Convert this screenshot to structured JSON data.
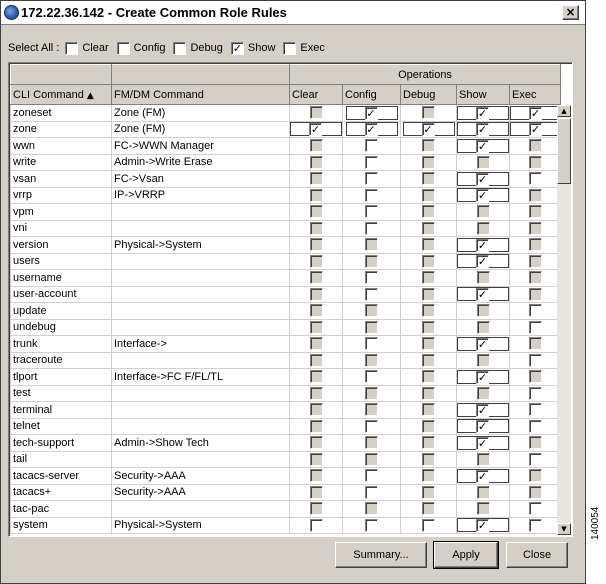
{
  "window": {
    "title": "172.22.36.142 - Create Common Role Rules",
    "close_symbol": "×"
  },
  "select_all": {
    "label": "Select All :",
    "options": [
      {
        "label": "Clear",
        "checked": false
      },
      {
        "label": "Config",
        "checked": false
      },
      {
        "label": "Debug",
        "checked": false
      },
      {
        "label": "Show",
        "checked": true
      },
      {
        "label": "Exec",
        "checked": false
      }
    ]
  },
  "table": {
    "operations_header": "Operations",
    "columns": {
      "cli": "CLI Command",
      "fmdm": "FM/DM Command",
      "clear": "Clear",
      "config": "Config",
      "debug": "Debug",
      "show": "Show",
      "exec": "Exec"
    },
    "sort_indicator": "▲",
    "rows": [
      {
        "cli": "zoneset",
        "fm": "Zone (FM)",
        "ops": [
          [
            "d",
            0,
            0
          ],
          [
            "e",
            1,
            1
          ],
          [
            "d",
            0,
            0
          ],
          [
            "e",
            1,
            1
          ],
          [
            "e",
            1,
            1
          ]
        ]
      },
      {
        "cli": "zone",
        "fm": "Zone (FM)",
        "ops": [
          [
            "e",
            1,
            1
          ],
          [
            "e",
            1,
            1
          ],
          [
            "e",
            1,
            1
          ],
          [
            "e",
            1,
            1
          ],
          [
            "e",
            1,
            1
          ]
        ]
      },
      {
        "cli": "wwn",
        "fm": "FC->WWN Manager",
        "ops": [
          [
            "d",
            0,
            0
          ],
          [
            "e",
            0,
            0
          ],
          [
            "d",
            0,
            0
          ],
          [
            "e",
            1,
            1
          ],
          [
            "d",
            0,
            0
          ]
        ]
      },
      {
        "cli": "write",
        "fm": "Admin->Write Erase",
        "ops": [
          [
            "d",
            0,
            0
          ],
          [
            "e",
            0,
            0
          ],
          [
            "d",
            0,
            0
          ],
          [
            "d",
            0,
            0
          ],
          [
            "d",
            0,
            0
          ]
        ]
      },
      {
        "cli": "vsan",
        "fm": "FC->Vsan",
        "ops": [
          [
            "d",
            0,
            0
          ],
          [
            "e",
            0,
            0
          ],
          [
            "d",
            0,
            0
          ],
          [
            "e",
            1,
            1
          ],
          [
            "e",
            0,
            0
          ]
        ]
      },
      {
        "cli": "vrrp",
        "fm": "IP->VRRP",
        "ops": [
          [
            "d",
            0,
            0
          ],
          [
            "e",
            0,
            0
          ],
          [
            "d",
            0,
            0
          ],
          [
            "e",
            1,
            1
          ],
          [
            "d",
            0,
            0
          ]
        ]
      },
      {
        "cli": "vpm",
        "fm": "",
        "ops": [
          [
            "d",
            0,
            0
          ],
          [
            "e",
            0,
            0
          ],
          [
            "d",
            0,
            0
          ],
          [
            "d",
            0,
            0
          ],
          [
            "d",
            0,
            0
          ]
        ]
      },
      {
        "cli": "vni",
        "fm": "",
        "ops": [
          [
            "d",
            0,
            0
          ],
          [
            "e",
            0,
            0
          ],
          [
            "d",
            0,
            0
          ],
          [
            "d",
            0,
            0
          ],
          [
            "d",
            0,
            0
          ]
        ]
      },
      {
        "cli": "version",
        "fm": "Physical->System",
        "ops": [
          [
            "d",
            0,
            0
          ],
          [
            "d",
            0,
            0
          ],
          [
            "d",
            0,
            0
          ],
          [
            "e",
            1,
            1
          ],
          [
            "d",
            0,
            0
          ]
        ]
      },
      {
        "cli": "users",
        "fm": "",
        "ops": [
          [
            "d",
            0,
            0
          ],
          [
            "d",
            0,
            0
          ],
          [
            "d",
            0,
            0
          ],
          [
            "e",
            1,
            1
          ],
          [
            "d",
            0,
            0
          ]
        ]
      },
      {
        "cli": "username",
        "fm": "",
        "ops": [
          [
            "d",
            0,
            0
          ],
          [
            "e",
            0,
            0
          ],
          [
            "d",
            0,
            0
          ],
          [
            "d",
            0,
            0
          ],
          [
            "d",
            0,
            0
          ]
        ]
      },
      {
        "cli": "user-account",
        "fm": "",
        "ops": [
          [
            "d",
            0,
            0
          ],
          [
            "e",
            0,
            0
          ],
          [
            "d",
            0,
            0
          ],
          [
            "e",
            1,
            1
          ],
          [
            "d",
            0,
            0
          ]
        ]
      },
      {
        "cli": "update",
        "fm": "",
        "ops": [
          [
            "d",
            0,
            0
          ],
          [
            "d",
            0,
            0
          ],
          [
            "d",
            0,
            0
          ],
          [
            "d",
            0,
            0
          ],
          [
            "e",
            0,
            0
          ]
        ]
      },
      {
        "cli": "undebug",
        "fm": "",
        "ops": [
          [
            "d",
            0,
            0
          ],
          [
            "d",
            0,
            0
          ],
          [
            "d",
            0,
            0
          ],
          [
            "d",
            0,
            0
          ],
          [
            "e",
            0,
            0
          ]
        ]
      },
      {
        "cli": "trunk",
        "fm": "Interface->",
        "ops": [
          [
            "d",
            0,
            0
          ],
          [
            "e",
            0,
            0
          ],
          [
            "d",
            0,
            0
          ],
          [
            "e",
            1,
            1
          ],
          [
            "d",
            0,
            0
          ]
        ]
      },
      {
        "cli": "traceroute",
        "fm": "",
        "ops": [
          [
            "d",
            0,
            0
          ],
          [
            "d",
            0,
            0
          ],
          [
            "d",
            0,
            0
          ],
          [
            "d",
            0,
            0
          ],
          [
            "e",
            0,
            0
          ]
        ]
      },
      {
        "cli": "tlport",
        "fm": "Interface->FC F/FL/TL",
        "ops": [
          [
            "d",
            0,
            0
          ],
          [
            "e",
            0,
            0
          ],
          [
            "d",
            0,
            0
          ],
          [
            "e",
            1,
            1
          ],
          [
            "d",
            0,
            0
          ]
        ]
      },
      {
        "cli": "test",
        "fm": "",
        "ops": [
          [
            "d",
            0,
            0
          ],
          [
            "d",
            0,
            0
          ],
          [
            "d",
            0,
            0
          ],
          [
            "d",
            0,
            0
          ],
          [
            "e",
            0,
            0
          ]
        ]
      },
      {
        "cli": "terminal",
        "fm": "",
        "ops": [
          [
            "d",
            0,
            0
          ],
          [
            "d",
            0,
            0
          ],
          [
            "d",
            0,
            0
          ],
          [
            "e",
            1,
            1
          ],
          [
            "e",
            0,
            0
          ]
        ]
      },
      {
        "cli": "telnet",
        "fm": "",
        "ops": [
          [
            "d",
            0,
            0
          ],
          [
            "e",
            0,
            0
          ],
          [
            "d",
            0,
            0
          ],
          [
            "e",
            1,
            1
          ],
          [
            "e",
            0,
            0
          ]
        ]
      },
      {
        "cli": "tech-support",
        "fm": "Admin->Show Tech",
        "ops": [
          [
            "d",
            0,
            0
          ],
          [
            "d",
            0,
            0
          ],
          [
            "d",
            0,
            0
          ],
          [
            "e",
            1,
            1
          ],
          [
            "d",
            0,
            0
          ]
        ]
      },
      {
        "cli": "tail",
        "fm": "",
        "ops": [
          [
            "d",
            0,
            0
          ],
          [
            "d",
            0,
            0
          ],
          [
            "d",
            0,
            0
          ],
          [
            "d",
            0,
            0
          ],
          [
            "e",
            0,
            0
          ]
        ]
      },
      {
        "cli": "tacacs-server",
        "fm": "Security->AAA",
        "ops": [
          [
            "d",
            0,
            0
          ],
          [
            "e",
            0,
            0
          ],
          [
            "d",
            0,
            0
          ],
          [
            "e",
            1,
            1
          ],
          [
            "d",
            0,
            0
          ]
        ]
      },
      {
        "cli": "tacacs+",
        "fm": "Security->AAA",
        "ops": [
          [
            "d",
            0,
            0
          ],
          [
            "e",
            0,
            0
          ],
          [
            "d",
            0,
            0
          ],
          [
            "d",
            0,
            0
          ],
          [
            "d",
            0,
            0
          ]
        ]
      },
      {
        "cli": "tac-pac",
        "fm": "",
        "ops": [
          [
            "d",
            0,
            0
          ],
          [
            "d",
            0,
            0
          ],
          [
            "d",
            0,
            0
          ],
          [
            "d",
            0,
            0
          ],
          [
            "e",
            0,
            0
          ]
        ]
      },
      {
        "cli": "system",
        "fm": "Physical->System",
        "ops": [
          [
            "e",
            0,
            0
          ],
          [
            "e",
            0,
            0
          ],
          [
            "e",
            0,
            0
          ],
          [
            "e",
            1,
            1
          ],
          [
            "e",
            0,
            0
          ]
        ]
      }
    ]
  },
  "buttons": {
    "summary": "Summary...",
    "apply": "Apply",
    "close": "Close"
  },
  "figure_id": "140054"
}
